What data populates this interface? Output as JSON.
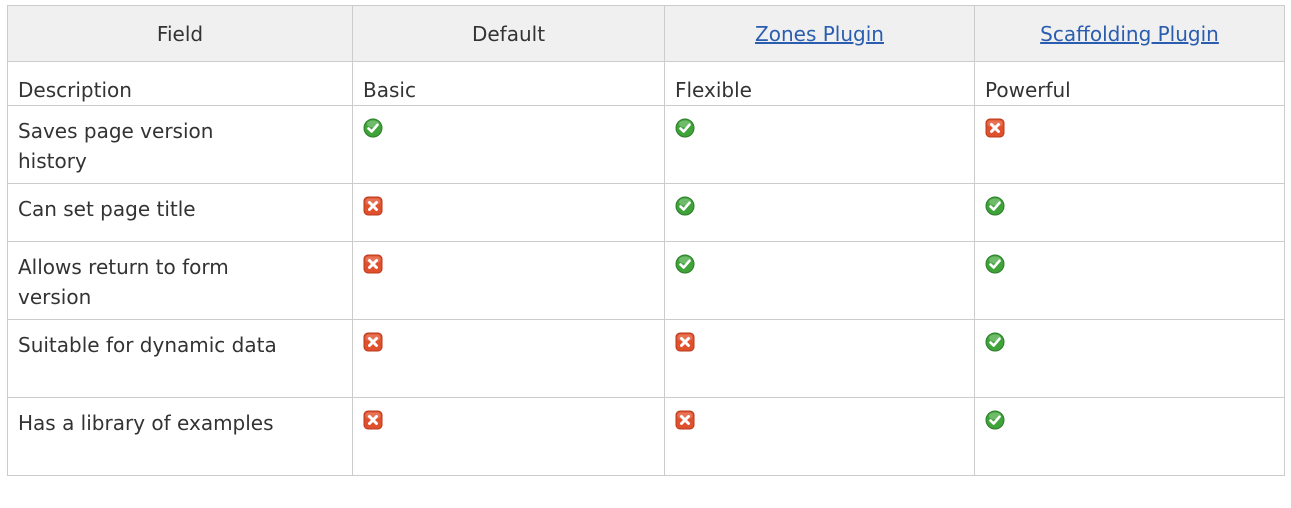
{
  "table": {
    "headers": [
      "Field",
      "Default",
      "Zones Plugin",
      "Scaffolding Plugin"
    ],
    "header_links": [
      false,
      false,
      true,
      true
    ],
    "rows": [
      {
        "field": "Description",
        "cells": [
          "Basic",
          "Flexible",
          "Powerful"
        ]
      },
      {
        "field": "Saves page version history",
        "cells": [
          "check-icon",
          "check-icon",
          "cross-icon"
        ]
      },
      {
        "field": "Can set page title",
        "cells": [
          "cross-icon",
          "check-icon",
          "check-icon"
        ]
      },
      {
        "field": "Allows return to form version",
        "cells": [
          "cross-icon",
          "check-icon",
          "check-icon"
        ]
      },
      {
        "field": "Suitable for dynamic data",
        "cells": [
          "cross-icon",
          "cross-icon",
          "check-icon"
        ]
      },
      {
        "field": "Has a library of examples",
        "cells": [
          "cross-icon",
          "cross-icon",
          "check-icon"
        ]
      }
    ]
  },
  "colors": {
    "header_bg": "#f0f0f0",
    "border": "#cccccc",
    "link": "#2a5db0",
    "check": "#3fa33a",
    "cross": "#e0502c"
  }
}
